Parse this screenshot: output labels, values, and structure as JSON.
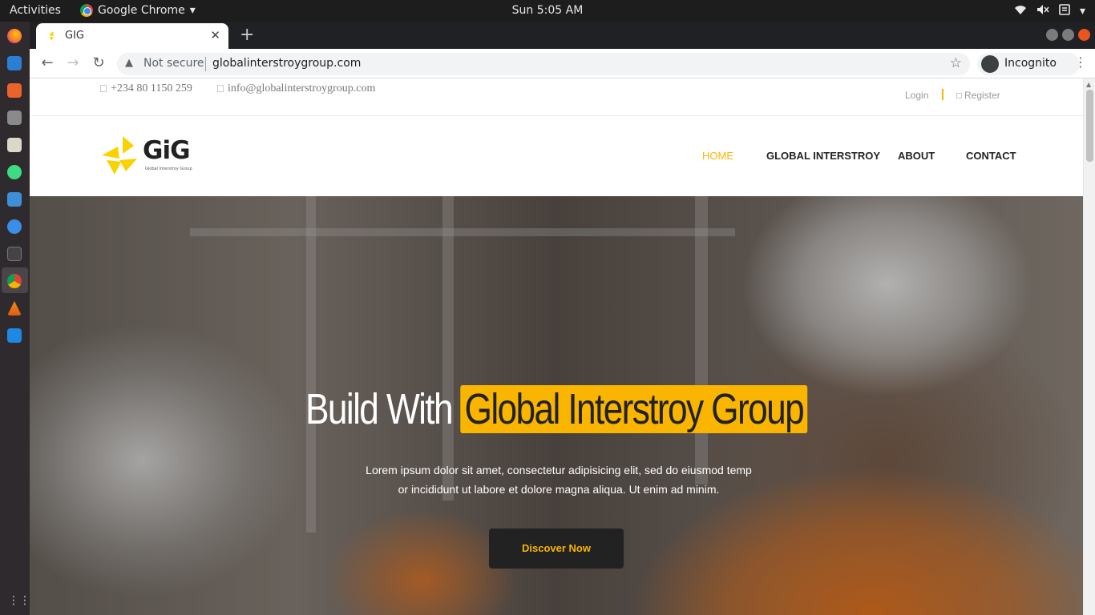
{
  "desktop": {
    "activities": "Activities",
    "app_name": "Google Chrome",
    "clock": "Sun  5:05 AM"
  },
  "browser": {
    "tab_title": "GIG",
    "security_label": "Not secure",
    "url": "globalinterstroygroup.com",
    "incognito_label": "Incognito"
  },
  "site": {
    "phone": "+234 80 1150 259",
    "email": "info@globalinterstroygroup.com",
    "login": "Login",
    "register": "Register",
    "logo_text": "GiG",
    "logo_sub": "Global Interstroy Group",
    "nav": {
      "home": "HOME",
      "global_interstroy": "GLOBAL INTERSTROY",
      "about": "ABOUT",
      "contact": "CONTACT"
    },
    "hero": {
      "title_plain": "Build With",
      "title_highlight": "Global Interstroy Group",
      "text_line1": "Lorem ipsum dolor sit amet, consectetur adipisicing elit, sed do eiusmod temp",
      "text_line2": "or incididunt ut labore et dolore magna aliqua. Ut enim ad minim.",
      "button": "Discover Now"
    }
  },
  "colors": {
    "accent": "#f9b500",
    "dark": "#222222"
  }
}
